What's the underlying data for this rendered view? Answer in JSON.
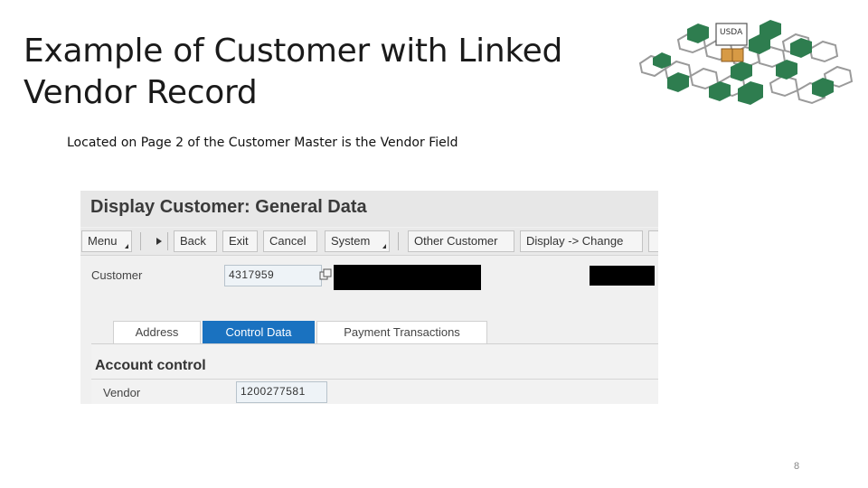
{
  "slide": {
    "title_line1": "Example of Customer with Linked",
    "title_line2": "Vendor Record",
    "subtitle": "Located on Page 2 of the Customer Master is the Vendor Field",
    "page_number": "8"
  },
  "logo": {
    "text": "USDA",
    "hex_color": "#2e7d4f"
  },
  "sap": {
    "window_title": "Display Customer: General Data",
    "toolbar": {
      "menu": "Menu",
      "back": "Back",
      "exit": "Exit",
      "cancel": "Cancel",
      "system": "System",
      "other_customer": "Other Customer",
      "display_change": "Display -> Change"
    },
    "customer_label": "Customer",
    "customer_value": "4317959",
    "tabs": [
      "Address",
      "Control Data",
      "Payment Transactions"
    ],
    "active_tab": "Control Data",
    "section_title": "Account control",
    "vendor_label": "Vendor",
    "vendor_value": "1200277581"
  }
}
